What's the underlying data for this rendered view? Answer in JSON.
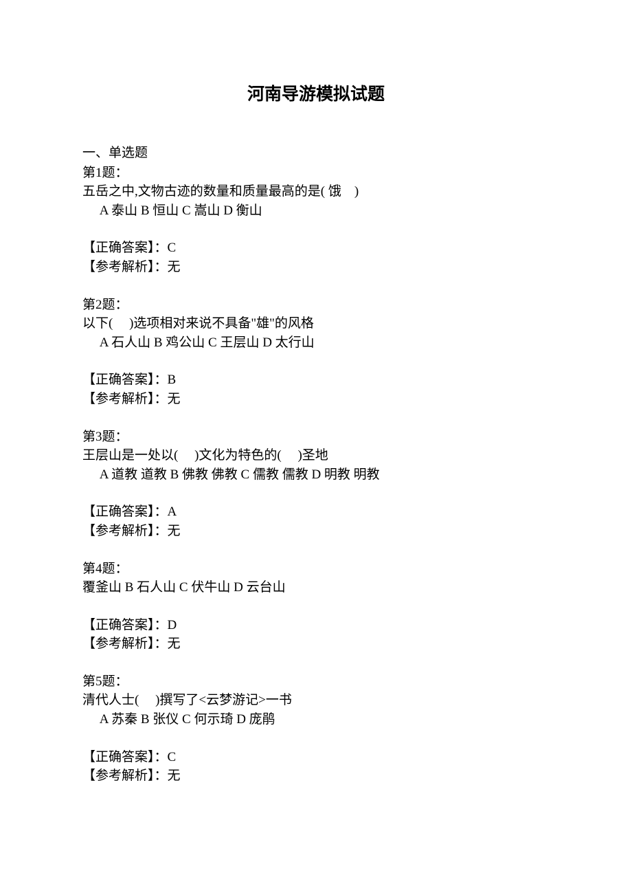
{
  "title": "河南导游模拟试题",
  "section_heading": "一、单选题",
  "questions": [
    {
      "number": "第1题：",
      "stem": "五岳之中,文物古迹的数量和质量最高的是( 饿　)",
      "options": "A 泰山 B 恒山 C 嵩山 D 衡山",
      "ans_label": "【正确答案】：",
      "ans_val": "C",
      "expl_label": "【参考解析】：",
      "expl_val": "无"
    },
    {
      "number": "第2题：",
      "stem": "以下(　 )选项相对来说不具备\"雄\"的风格",
      "options": "A 石人山 B 鸡公山 C 王层山 D 太行山",
      "ans_label": "【正确答案】：",
      "ans_val": "B",
      "expl_label": "【参考解析】：",
      "expl_val": "无"
    },
    {
      "number": "第3题：",
      "stem": "王层山是一处以(　 )文化为特色的(　 )圣地",
      "options": "A 道教 道教 B 佛教 佛教 C 儒教 儒教 D 明教 明教",
      "ans_label": "【正确答案】：",
      "ans_val": "A",
      "expl_label": "【参考解析】：",
      "expl_val": "无"
    },
    {
      "number": "第4题：",
      "stem": "覆釜山 B 石人山 C 伏牛山 D 云台山",
      "options": "",
      "ans_label": "【正确答案】：",
      "ans_val": "D",
      "expl_label": "【参考解析】：",
      "expl_val": "无"
    },
    {
      "number": "第5题：",
      "stem": "清代人士(　 )撰写了<云梦游记>一书",
      "options": "A 苏秦 B 张仪 C 何示琦 D 庞鹃",
      "ans_label": "【正确答案】：",
      "ans_val": "C",
      "expl_label": "【参考解析】：",
      "expl_val": "无"
    }
  ]
}
